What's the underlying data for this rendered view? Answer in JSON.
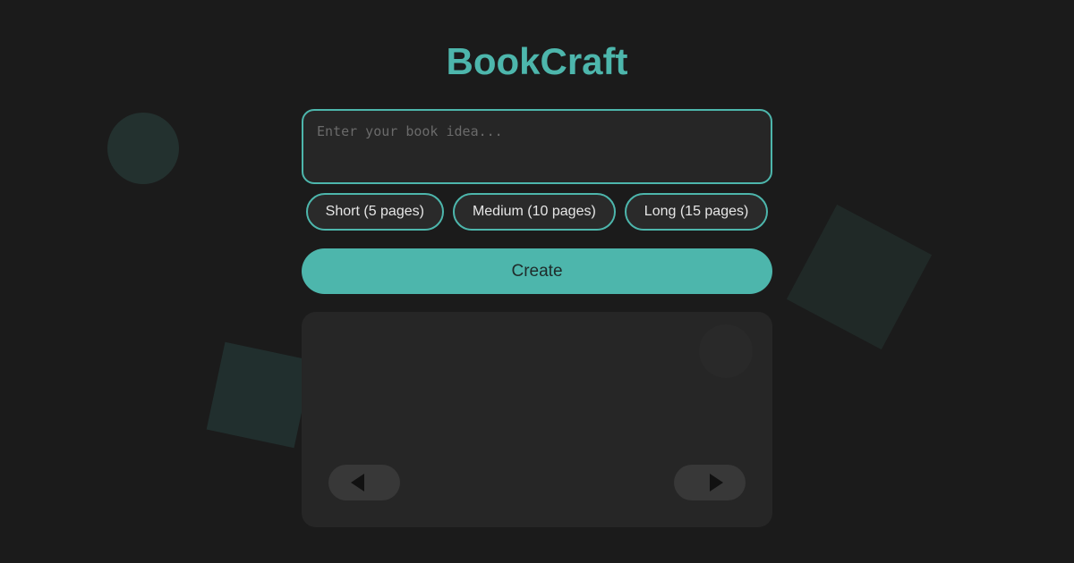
{
  "app": {
    "title": "BookCraft",
    "accent_color": "#4db6ac",
    "background_color": "#1b1b1b"
  },
  "idea_input": {
    "value": "",
    "placeholder": "Enter your book idea..."
  },
  "length_options": [
    {
      "label": "Short (5 pages)"
    },
    {
      "label": "Medium (10 pages)"
    },
    {
      "label": "Long (15 pages)"
    }
  ],
  "create_button": {
    "label": "Create"
  },
  "book_viewer": {
    "prev_icon": "triangle-left-icon",
    "next_icon": "triangle-right-icon"
  }
}
